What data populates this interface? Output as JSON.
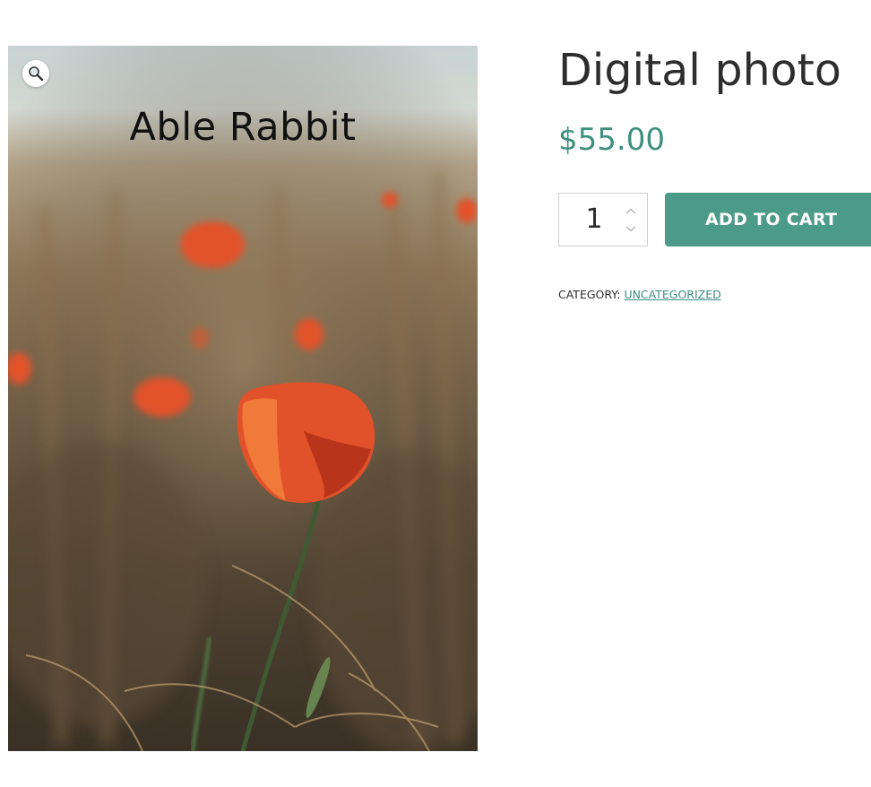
{
  "product": {
    "image": {
      "caption": "Able Rabbit",
      "alt": "Red poppy flower in a field of dry grass",
      "zoom_icon": "magnifier-icon"
    },
    "title": "Digital photo",
    "price": "$55.00",
    "quantity": "1",
    "add_to_cart_label": "ADD TO CART",
    "meta": {
      "category_label": "CATEGORY:",
      "category_value": "UNCATEGORIZED"
    }
  },
  "colors": {
    "accent": "#4c9a88",
    "price": "#3e8f7e",
    "text": "#2b2b2b"
  }
}
